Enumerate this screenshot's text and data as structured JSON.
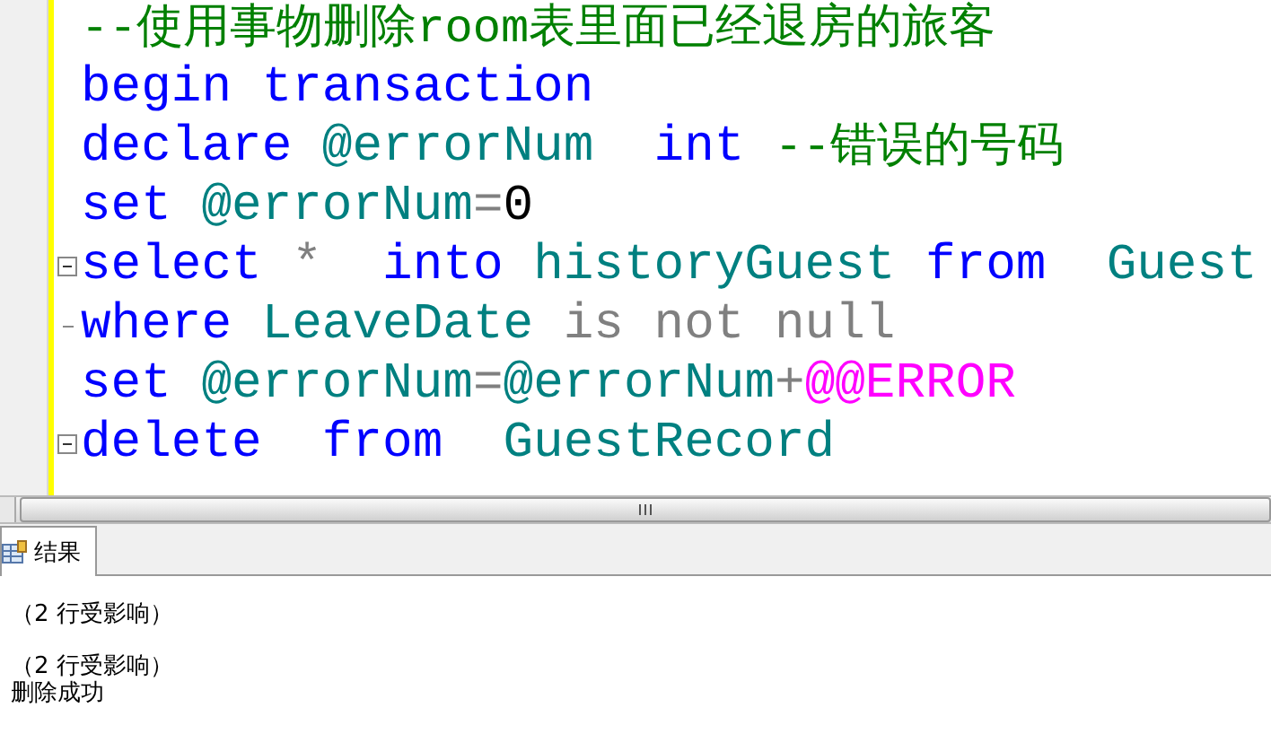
{
  "editor": {
    "lines": [
      {
        "kind": "plain",
        "tokens": [
          {
            "kind": "comment",
            "text": "--使用事物删除room表里面已经退房的旅客"
          }
        ]
      },
      {
        "kind": "plain",
        "tokens": [
          {
            "kind": "keyword",
            "text": "begin transaction"
          }
        ]
      },
      {
        "kind": "plain",
        "tokens": [
          {
            "kind": "keyword",
            "text": "declare "
          },
          {
            "kind": "identifier",
            "text": "@errorNum  "
          },
          {
            "kind": "keyword",
            "text": "int "
          },
          {
            "kind": "comment",
            "text": "--错误的号码"
          }
        ]
      },
      {
        "kind": "plain",
        "tokens": [
          {
            "kind": "keyword",
            "text": "set "
          },
          {
            "kind": "identifier",
            "text": "@errorNum"
          },
          {
            "kind": "operator",
            "text": "="
          },
          {
            "kind": "literal",
            "text": "0"
          }
        ]
      },
      {
        "kind": "fold-start",
        "tokens": [
          {
            "kind": "keyword",
            "text": "select "
          },
          {
            "kind": "operator",
            "text": "*  "
          },
          {
            "kind": "keyword",
            "text": "into "
          },
          {
            "kind": "identifier",
            "text": "historyGuest "
          },
          {
            "kind": "keyword",
            "text": "from  "
          },
          {
            "kind": "identifier",
            "text": "Guest"
          }
        ]
      },
      {
        "kind": "fold-end",
        "tokens": [
          {
            "kind": "keyword",
            "text": "where "
          },
          {
            "kind": "identifier",
            "text": "LeaveDate "
          },
          {
            "kind": "operator",
            "text": "is not null"
          }
        ]
      },
      {
        "kind": "plain",
        "tokens": [
          {
            "kind": "keyword",
            "text": "set "
          },
          {
            "kind": "identifier",
            "text": "@errorNum"
          },
          {
            "kind": "operator",
            "text": "="
          },
          {
            "kind": "identifier",
            "text": "@errorNum"
          },
          {
            "kind": "operator",
            "text": "+"
          },
          {
            "kind": "system",
            "text": "@@ERROR"
          }
        ]
      },
      {
        "kind": "fold-start",
        "tokens": [
          {
            "kind": "keyword",
            "text": "delete  from  "
          },
          {
            "kind": "identifier",
            "text": "GuestRecord"
          }
        ]
      }
    ]
  },
  "tabs": [
    {
      "label": "结果",
      "selected": true
    }
  ],
  "messages": [
    "（2 行受影响）",
    "（2 行受影响）",
    "删除成功"
  ]
}
